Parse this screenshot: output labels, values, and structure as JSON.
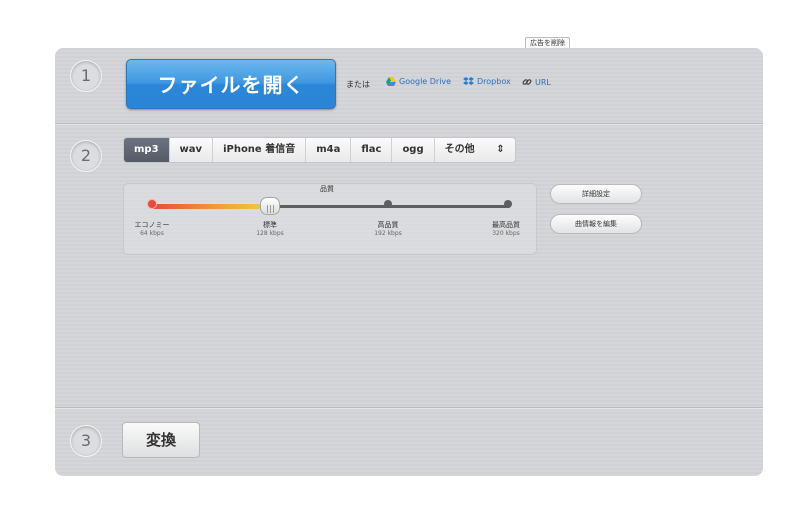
{
  "ad": {
    "remove_label": "広告を削除"
  },
  "steps": {
    "one": "1",
    "two": "2",
    "three": "3"
  },
  "open": {
    "button_label": "ファイルを開く",
    "or_label": "または",
    "sources": {
      "gdrive": "Google Drive",
      "dropbox": "Dropbox",
      "url": "URL"
    }
  },
  "formats": {
    "tabs": [
      "mp3",
      "wav",
      "iPhone 着信音",
      "m4a",
      "flac",
      "ogg",
      "その他"
    ],
    "selected": "mp3",
    "more_arrow": "⇕"
  },
  "quality": {
    "title": "品質",
    "levels": [
      {
        "label": "エコノミー",
        "bitrate": "64 kbps"
      },
      {
        "label": "標準",
        "bitrate": "128 kbps"
      },
      {
        "label": "高品質",
        "bitrate": "192 kbps"
      },
      {
        "label": "最高品質",
        "bitrate": "320 kbps"
      }
    ],
    "selected_index": 1
  },
  "side_buttons": {
    "advanced": "詳細設定",
    "edit_info": "曲情報を編集"
  },
  "convert": {
    "label": "変換"
  },
  "colors": {
    "accent": "#3f96e0",
    "link": "#2f6fbf",
    "active_tab": "#5f6470"
  }
}
